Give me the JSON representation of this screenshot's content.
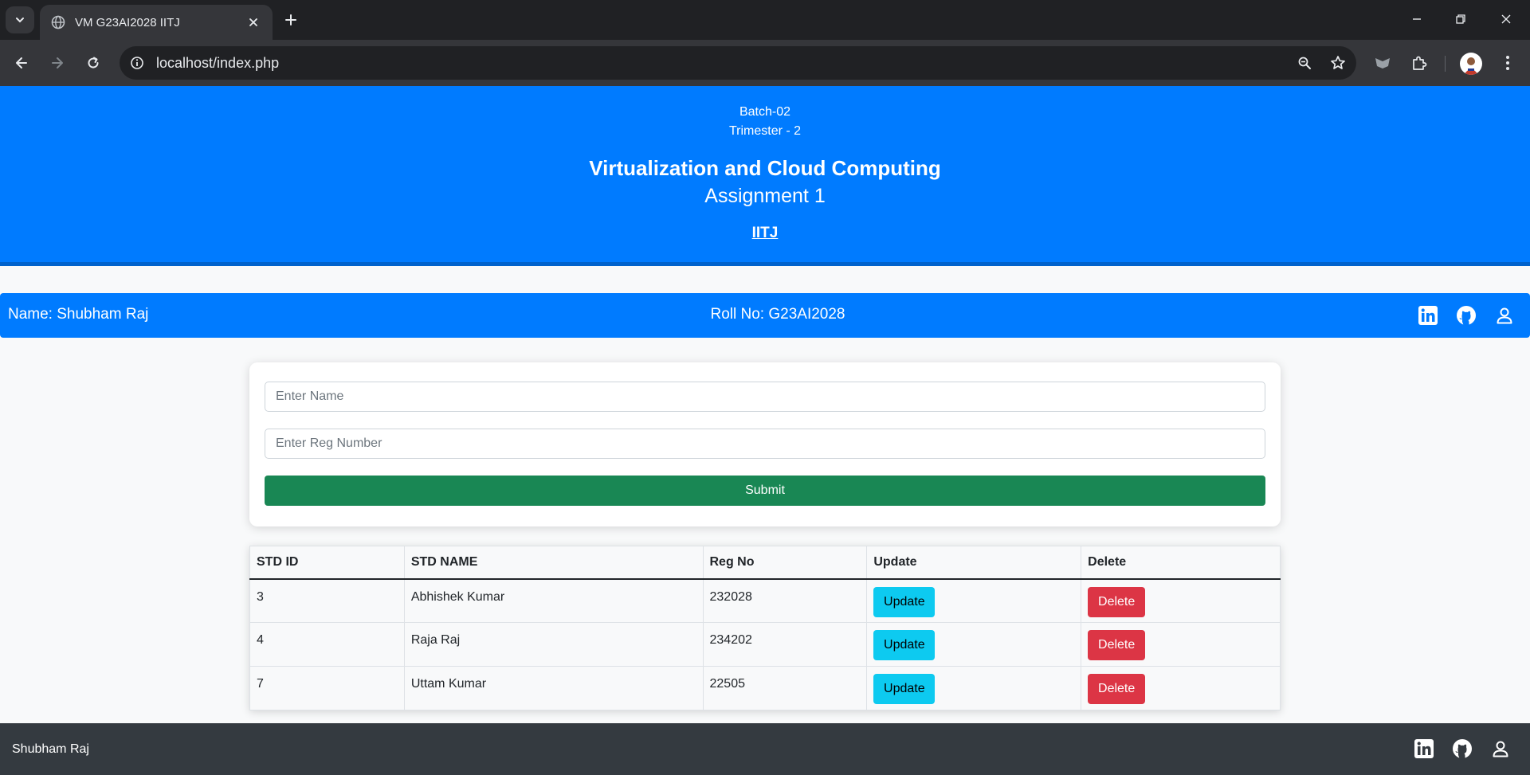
{
  "browser": {
    "tab_title": "VM G23AI2028 IITJ",
    "url": "localhost/index.php"
  },
  "header": {
    "batch": "Batch-02",
    "trimester": "Trimester - 2",
    "course": "Virtualization and Cloud Computing",
    "assignment": "Assignment 1",
    "institute": "IITJ"
  },
  "student_bar": {
    "name": "Name: Shubham Raj",
    "roll": "Roll No: G23AI2028",
    "icons": [
      "linkedin-icon",
      "github-icon",
      "user-icon"
    ]
  },
  "form": {
    "name_placeholder": "Enter Name",
    "name_value": "",
    "reg_placeholder": "Enter Reg Number",
    "reg_value": "",
    "submit_label": "Submit"
  },
  "table": {
    "columns": [
      "STD ID",
      "STD NAME",
      "Reg No",
      "Update",
      "Delete"
    ],
    "rows": [
      {
        "id": "3",
        "name": "Abhishek Kumar",
        "reg": "232028",
        "update_label": "Update",
        "delete_label": "Delete"
      },
      {
        "id": "4",
        "name": "Raja Raj",
        "reg": "234202",
        "update_label": "Update",
        "delete_label": "Delete"
      },
      {
        "id": "7",
        "name": "Uttam Kumar",
        "reg": "22505",
        "update_label": "Update",
        "delete_label": "Delete"
      }
    ]
  },
  "footer": {
    "name": "Shubham Raj",
    "icons": [
      "linkedin-icon",
      "github-icon",
      "user-icon"
    ]
  },
  "colors": {
    "primary": "#007bff",
    "success": "#198754",
    "info": "#0dcaf0",
    "danger": "#dc3545",
    "footer": "#343a40"
  }
}
